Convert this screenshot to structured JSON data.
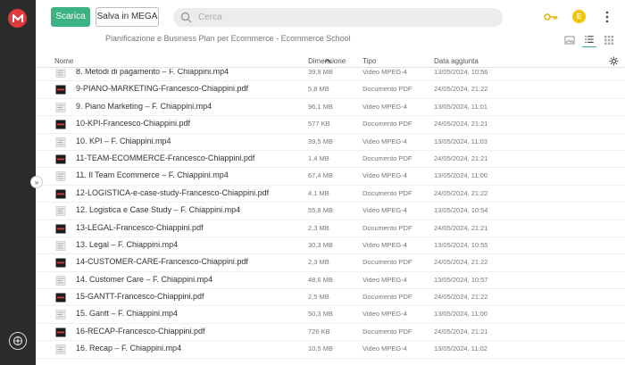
{
  "header": {
    "download_label": "Scarica",
    "save_label": "Salva in MEGA",
    "search_placeholder": "Cerca",
    "avatar_letter": "E"
  },
  "breadcrumb": "Pianificazione e Business Plan per Ecommerce - Ecommerce School",
  "colors": {
    "accent": "#3db384",
    "brand": "#e0393e",
    "avatar": "#f5c400",
    "rail": "#2b2b2b"
  },
  "columns": {
    "name": "Nome",
    "size": "Dimensione",
    "type": "Tipo",
    "date": "Data aggiunta"
  },
  "rows": [
    {
      "name": "8. Metodi di pagamento – F. Chiappini.mp4",
      "size": "39,9 MB",
      "type": "Video MPEG-4",
      "date": "13/05/2024, 10:56",
      "kind": "video"
    },
    {
      "name": "9-PIANO-MARKETING-Francesco-Chiappini.pdf",
      "size": "5,8 MB",
      "type": "Documento PDF",
      "date": "24/05/2024, 21:22",
      "kind": "pdf"
    },
    {
      "name": "9. Piano Marketing – F. Chiappini.mp4",
      "size": "96,1 MB",
      "type": "Video MPEG-4",
      "date": "13/05/2024, 11:01",
      "kind": "video"
    },
    {
      "name": "10-KPI-Francesco-Chiappini.pdf",
      "size": "577 KB",
      "type": "Documento PDF",
      "date": "24/05/2024, 21:21",
      "kind": "pdf"
    },
    {
      "name": "10. KPI – F. Chiappini.mp4",
      "size": "39,5 MB",
      "type": "Video MPEG-4",
      "date": "13/05/2024, 11:03",
      "kind": "video"
    },
    {
      "name": "11-TEAM-ECOMMERCE-Francesco-Chiappini.pdf",
      "size": "1,4 MB",
      "type": "Documento PDF",
      "date": "24/05/2024, 21:21",
      "kind": "pdf"
    },
    {
      "name": "11. Il Team Ecommerce – F. Chiappini.mp4",
      "size": "67,4 MB",
      "type": "Video MPEG-4",
      "date": "13/05/2024, 11:00",
      "kind": "video"
    },
    {
      "name": "12-LOGISTICA-e-case-study-Francesco-Chiappini.pdf",
      "size": "4,1 MB",
      "type": "Documento PDF",
      "date": "24/05/2024, 21:22",
      "kind": "pdf"
    },
    {
      "name": "12. Logistica e Case Study – F. Chiappini.mp4",
      "size": "55,8 MB",
      "type": "Video MPEG-4",
      "date": "13/05/2024, 10:54",
      "kind": "video"
    },
    {
      "name": "13-LEGAL-Francesco-Chiappini.pdf",
      "size": "2,3 MB",
      "type": "Documento PDF",
      "date": "24/05/2024, 21:21",
      "kind": "pdf"
    },
    {
      "name": "13. Legal – F. Chiappini.mp4",
      "size": "30,3 MB",
      "type": "Video MPEG-4",
      "date": "13/05/2024, 10:55",
      "kind": "video"
    },
    {
      "name": "14-CUSTOMER-CARE-Francesco-Chiappini.pdf",
      "size": "2,3 MB",
      "type": "Documento PDF",
      "date": "24/05/2024, 21:22",
      "kind": "pdf"
    },
    {
      "name": "14. Customer Care – F. Chiappini.mp4",
      "size": "48,6 MB",
      "type": "Video MPEG-4",
      "date": "13/05/2024, 10:57",
      "kind": "video"
    },
    {
      "name": "15-GANTT-Francesco-Chiappini.pdf",
      "size": "2,5 MB",
      "type": "Documento PDF",
      "date": "24/05/2024, 21:22",
      "kind": "pdf"
    },
    {
      "name": "15. Gantt – F. Chiappini.mp4",
      "size": "50,3 MB",
      "type": "Video MPEG-4",
      "date": "13/05/2024, 11:00",
      "kind": "video"
    },
    {
      "name": "16-RECAP-Francesco-Chiappini.pdf",
      "size": "726 KB",
      "type": "Documento PDF",
      "date": "24/05/2024, 21:21",
      "kind": "pdf"
    },
    {
      "name": "16. Recap – F. Chiappini.mp4",
      "size": "10,5 MB",
      "type": "Video MPEG-4",
      "date": "13/05/2024, 11:02",
      "kind": "video"
    }
  ]
}
